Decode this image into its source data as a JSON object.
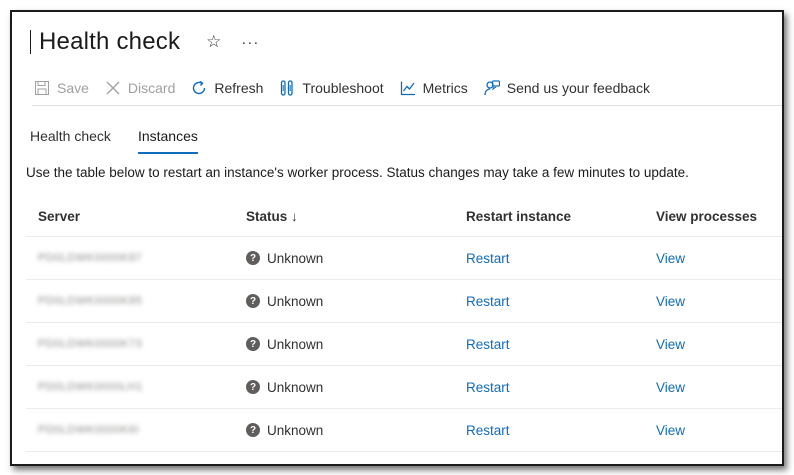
{
  "header": {
    "title": "Health check"
  },
  "toolbar": {
    "save": "Save",
    "discard": "Discard",
    "refresh": "Refresh",
    "troubleshoot": "Troubleshoot",
    "metrics": "Metrics",
    "feedback": "Send us your feedback"
  },
  "tabs": [
    {
      "label": "Health check",
      "active": false
    },
    {
      "label": "Instances",
      "active": true
    }
  ],
  "description": "Use the table below to restart an instance's worker process. Status changes may take a few minutes to update.",
  "table": {
    "columns": [
      "Server",
      "Status ↓",
      "Restart instance",
      "View processes"
    ],
    "rows": [
      {
        "server": "PD0LDWK0000K87",
        "status": "Unknown",
        "restart": "Restart",
        "view": "View"
      },
      {
        "server": "PD0LDWK0000K85",
        "status": "Unknown",
        "restart": "Restart",
        "view": "View"
      },
      {
        "server": "PD0LDWK0000K73",
        "status": "Unknown",
        "restart": "Restart",
        "view": "View"
      },
      {
        "server": "PD0LDWK0000LH1",
        "status": "Unknown",
        "restart": "Restart",
        "view": "View"
      },
      {
        "server": "PD0LDWK0000K6I",
        "status": "Unknown",
        "restart": "Restart",
        "view": "View"
      }
    ]
  },
  "colors": {
    "accent": "#0f6cbd",
    "border": "#e1dfdd",
    "disabled": "#a19f9d"
  }
}
